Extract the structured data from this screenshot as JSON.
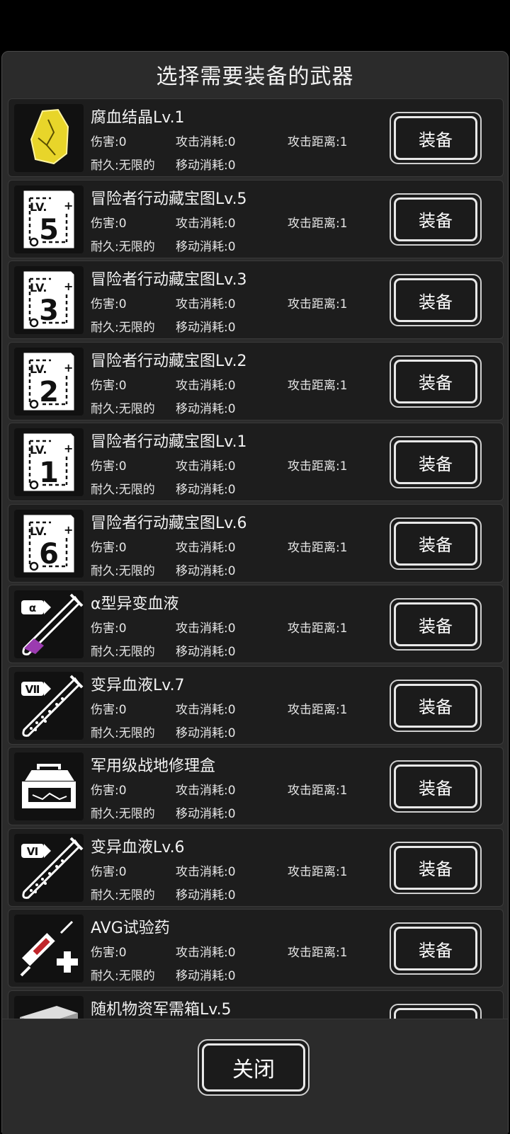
{
  "dialog": {
    "title": "选择需要装备的武器",
    "close_label": "关闭"
  },
  "items": [
    {
      "icon": "crystal-icon",
      "name": "腐血结晶Lv.1",
      "damage": "伤害:0",
      "attack_cost": "攻击消耗:0",
      "range": "攻击距离:1",
      "durability": "耐久:无限的",
      "move_cost": "移动消耗:0",
      "button": "装备"
    },
    {
      "icon": "treasure-map-icon",
      "level": "5",
      "name": "冒险者行动藏宝图Lv.5",
      "damage": "伤害:0",
      "attack_cost": "攻击消耗:0",
      "range": "攻击距离:1",
      "durability": "耐久:无限的",
      "move_cost": "移动消耗:0",
      "button": "装备"
    },
    {
      "icon": "treasure-map-icon",
      "level": "3",
      "name": "冒险者行动藏宝图Lv.3",
      "damage": "伤害:0",
      "attack_cost": "攻击消耗:0",
      "range": "攻击距离:1",
      "durability": "耐久:无限的",
      "move_cost": "移动消耗:0",
      "button": "装备"
    },
    {
      "icon": "treasure-map-icon",
      "level": "2",
      "name": "冒险者行动藏宝图Lv.2",
      "damage": "伤害:0",
      "attack_cost": "攻击消耗:0",
      "range": "攻击距离:1",
      "durability": "耐久:无限的",
      "move_cost": "移动消耗:0",
      "button": "装备"
    },
    {
      "icon": "treasure-map-icon",
      "level": "1",
      "name": "冒险者行动藏宝图Lv.1",
      "damage": "伤害:0",
      "attack_cost": "攻击消耗:0",
      "range": "攻击距离:1",
      "durability": "耐久:无限的",
      "move_cost": "移动消耗:0",
      "button": "装备"
    },
    {
      "icon": "treasure-map-icon",
      "level": "6",
      "name": "冒险者行动藏宝图Lv.6",
      "damage": "伤害:0",
      "attack_cost": "攻击消耗:0",
      "range": "攻击距离:1",
      "durability": "耐久:无限的",
      "move_cost": "移动消耗:0",
      "button": "装备"
    },
    {
      "icon": "test-tube-icon",
      "level": "α",
      "name": "α型异变血液",
      "damage": "伤害:0",
      "attack_cost": "攻击消耗:0",
      "range": "攻击距离:1",
      "durability": "耐久:无限的",
      "move_cost": "移动消耗:0",
      "button": "装备"
    },
    {
      "icon": "test-tube-icon",
      "level": "Ⅶ",
      "name": "变异血液Lv.7",
      "damage": "伤害:0",
      "attack_cost": "攻击消耗:0",
      "range": "攻击距离:1",
      "durability": "耐久:无限的",
      "move_cost": "移动消耗:0",
      "button": "装备"
    },
    {
      "icon": "toolbox-icon",
      "name": "军用级战地修理盒",
      "damage": "伤害:0",
      "attack_cost": "攻击消耗:0",
      "range": "攻击距离:1",
      "durability": "耐久:无限的",
      "move_cost": "移动消耗:0",
      "button": "装备"
    },
    {
      "icon": "test-tube-icon",
      "level": "Ⅵ",
      "name": "变异血液Lv.6",
      "damage": "伤害:0",
      "attack_cost": "攻击消耗:0",
      "range": "攻击距离:1",
      "durability": "耐久:无限的",
      "move_cost": "移动消耗:0",
      "button": "装备"
    },
    {
      "icon": "syringe-icon",
      "name": "AVG试验药",
      "damage": "伤害:0",
      "attack_cost": "攻击消耗:0",
      "range": "攻击距离:1",
      "durability": "耐久:无限的",
      "move_cost": "移动消耗:0",
      "button": "装备"
    },
    {
      "icon": "supply-crate-icon",
      "name": "随机物资军需箱Lv.5",
      "damage": "",
      "attack_cost": "",
      "range": "",
      "durability": "",
      "move_cost": "",
      "button": ""
    }
  ],
  "colors": {
    "crystal": "#e8d52a",
    "purple_liquid": "#9b3bb0",
    "syringe_red": "#c0262b"
  }
}
